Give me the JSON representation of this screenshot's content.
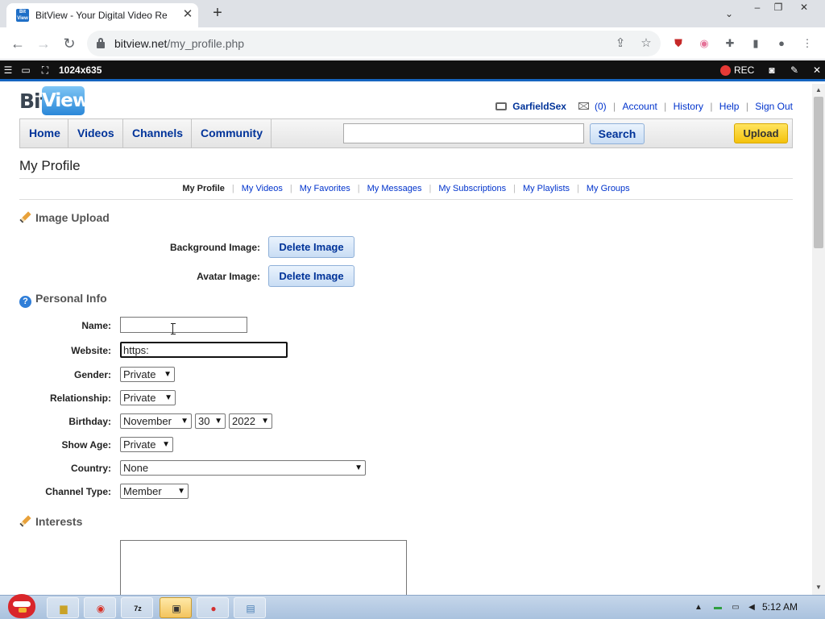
{
  "browser": {
    "tab_title": "BitView - Your Digital Video Re",
    "favicon_text": "Bit View",
    "url_host": "bitview.net",
    "url_path": "/my_profile.php"
  },
  "recorder": {
    "size": "1024x635",
    "rec_label": "REC"
  },
  "site": {
    "logo_bit": "Bit",
    "logo_view": "View",
    "user": {
      "username": "GarfieldSex",
      "messages": "(0)",
      "links": [
        "Account",
        "History",
        "Help",
        "Sign Out"
      ]
    },
    "nav": [
      "Home",
      "Videos",
      "Channels",
      "Community"
    ],
    "search_button": "Search",
    "upload_button": "Upload"
  },
  "page": {
    "title": "My Profile",
    "subnav": [
      "My Profile",
      "My Videos",
      "My Favorites",
      "My Messages",
      "My Subscriptions",
      "My Playlists",
      "My Groups"
    ]
  },
  "image_upload": {
    "heading": "Image Upload",
    "background_label": "Background Image:",
    "avatar_label": "Avatar Image:",
    "delete_label": "Delete Image"
  },
  "personal_info": {
    "heading": "Personal Info",
    "name_label": "Name:",
    "name_value": "",
    "website_label": "Website:",
    "website_value": "https:",
    "gender_label": "Gender:",
    "gender_value": "Private",
    "relationship_label": "Relationship:",
    "relationship_value": "Private",
    "birthday_label": "Birthday:",
    "birthday_month": "November",
    "birthday_day": "30",
    "birthday_year": "2022",
    "show_age_label": "Show Age:",
    "show_age_value": "Private",
    "country_label": "Country:",
    "country_value": "None",
    "channel_type_label": "Channel Type:",
    "channel_type_value": "Member"
  },
  "interests": {
    "heading": "Interests"
  },
  "taskbar": {
    "clock": "5:12 AM"
  }
}
